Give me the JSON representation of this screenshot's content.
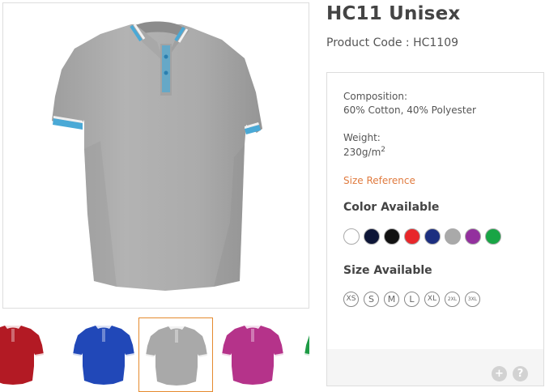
{
  "product": {
    "title": "HC11 Unisex",
    "code_label": "Product Code : ",
    "code_value": "HC1109"
  },
  "details": {
    "composition_label": "Composition:",
    "composition_value": "60% Cotton, 40% Polyester",
    "weight_label": "Weight:",
    "weight_value": "230g/m",
    "weight_sup": "2",
    "size_reference_link": "Size Reference"
  },
  "colors": {
    "heading": "Color Available",
    "swatches": [
      "#ffffff",
      "#0d1537",
      "#111111",
      "#e8262a",
      "#1c2f80",
      "#a9a9a9",
      "#93309e",
      "#18a545"
    ]
  },
  "sizes": {
    "heading": "Size Available",
    "options": [
      "XS",
      "S",
      "M",
      "L",
      "XL",
      "2XL",
      "3XL"
    ]
  },
  "thumbnails": {
    "colors": [
      "#b31a24",
      "#2148b8",
      "#a9a9a9",
      "#b5338a",
      "#1e9b45"
    ],
    "selected_index": 2
  },
  "footer": {
    "plus_icon": "+",
    "help_icon": "?"
  }
}
